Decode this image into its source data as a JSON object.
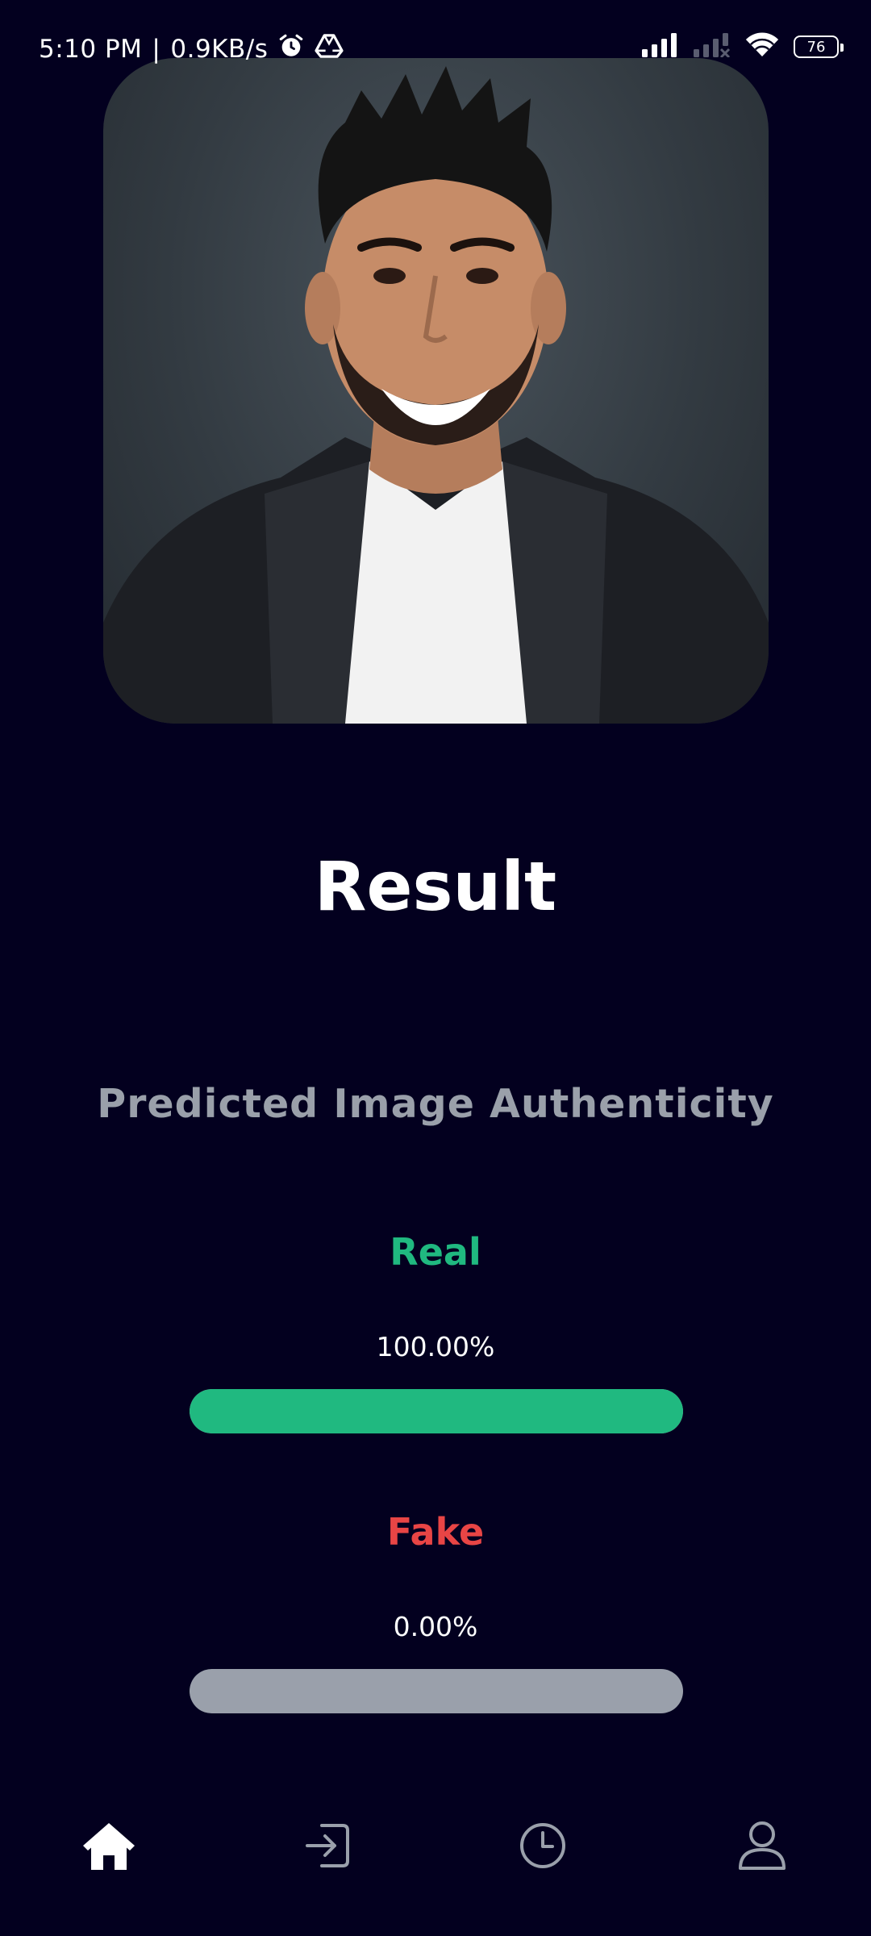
{
  "status_bar": {
    "time": "5:10 PM",
    "separator": "|",
    "network_speed": "0.9KB/s",
    "battery_level": "76",
    "icons": [
      "alarm-icon",
      "drive-icon",
      "signal-icon",
      "signal-x-icon",
      "wifi-icon",
      "battery-icon"
    ]
  },
  "result": {
    "title": "Result",
    "subtitle": "Predicted Image Authenticity",
    "real": {
      "label": "Real",
      "percent_text": "100.00%",
      "fraction": 1.0,
      "color": "#20b980"
    },
    "fake": {
      "label": "Fake",
      "percent_text": "0.00%",
      "fraction": 0.0,
      "color": "#e84545"
    },
    "track_color": "#9aa0ab"
  },
  "bottom_nav": {
    "items": [
      {
        "icon": "home-icon",
        "active": true
      },
      {
        "icon": "login-icon",
        "active": false
      },
      {
        "icon": "history-icon",
        "active": false
      },
      {
        "icon": "profile-icon",
        "active": false
      }
    ]
  }
}
